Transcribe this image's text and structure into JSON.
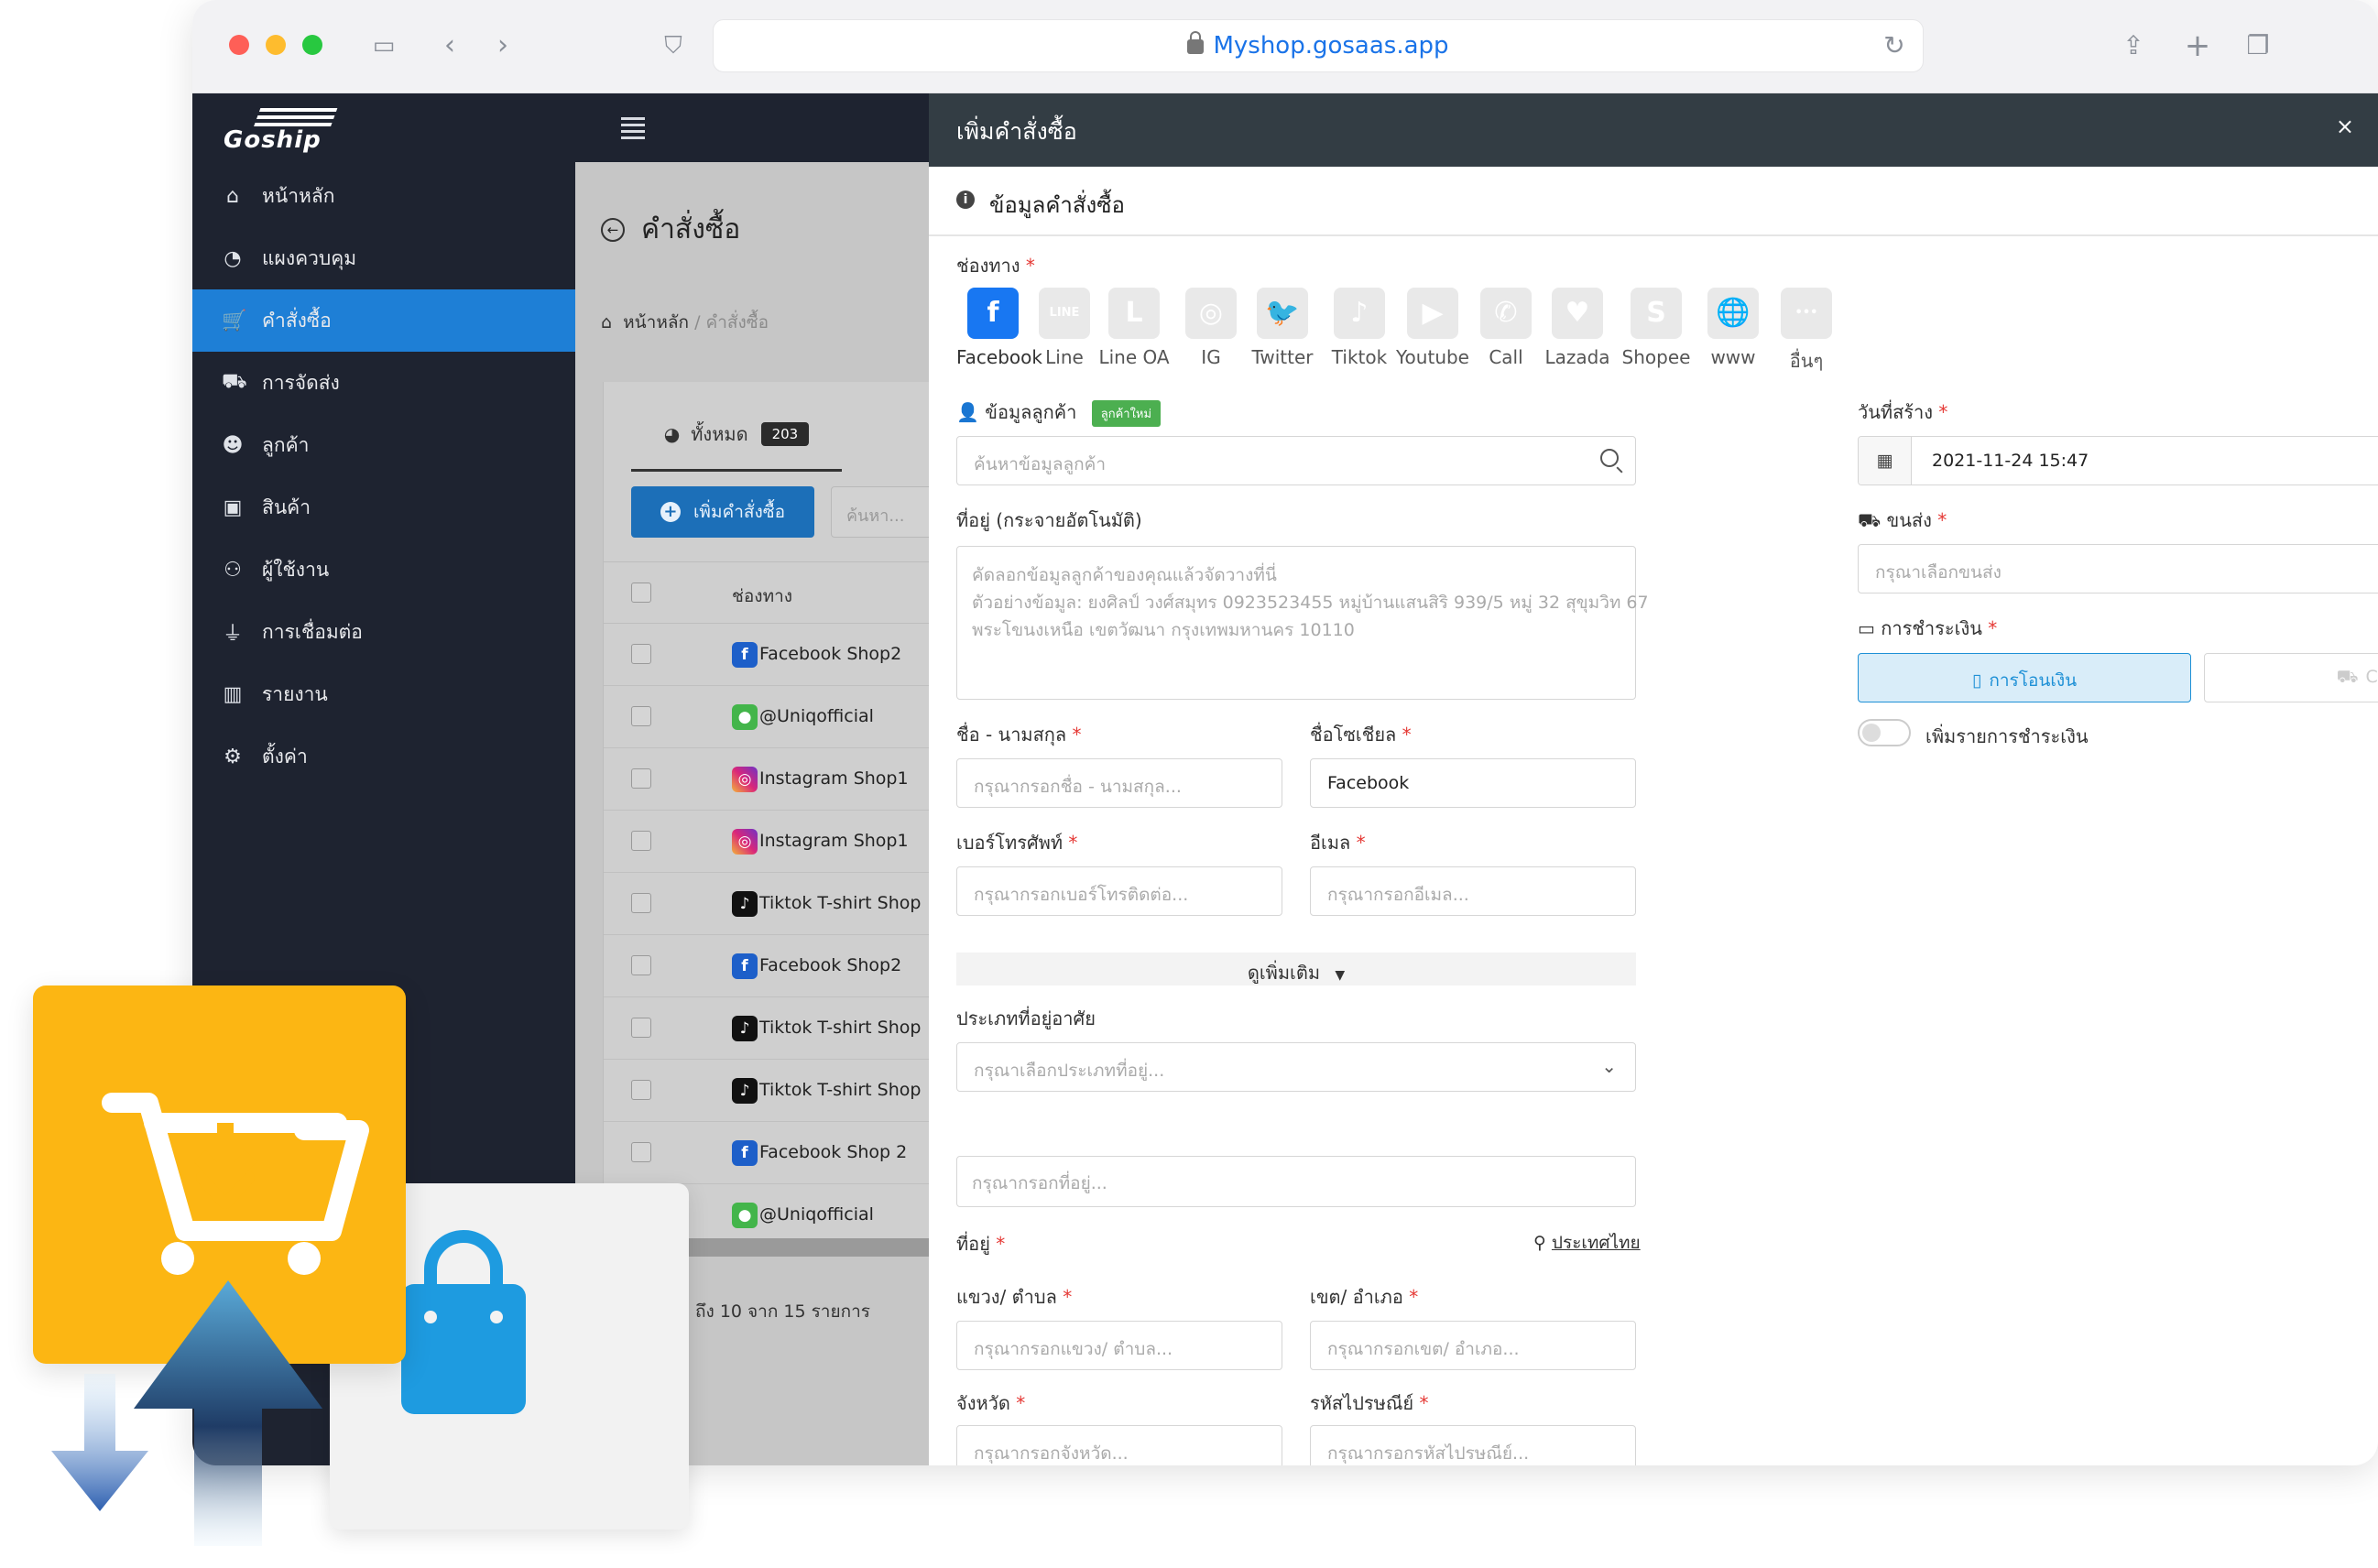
{
  "browser": {
    "url": "Myshop.gosaas.app"
  },
  "app": {
    "logo_text": "Goship"
  },
  "sidebar": {
    "items": [
      {
        "label": "หน้าหลัก",
        "icon": "home-icon",
        "glyph": "⌂"
      },
      {
        "label": "แผงควบคุม",
        "icon": "dashboard-icon",
        "glyph": "◔"
      },
      {
        "label": "คำสั่งซื้อ",
        "icon": "cart-icon",
        "glyph": "🛒",
        "active": true
      },
      {
        "label": "การจัดส่ง",
        "icon": "truck-icon",
        "glyph": "⛟"
      },
      {
        "label": "ลูกค้า",
        "icon": "users-icon",
        "glyph": "☻"
      },
      {
        "label": "สินค้า",
        "icon": "box-icon",
        "glyph": "▣"
      },
      {
        "label": "ผู้ใช้งาน",
        "icon": "user-gear-icon",
        "glyph": "⚇"
      },
      {
        "label": "การเชื่อมต่อ",
        "icon": "plug-icon",
        "glyph": "⏚"
      },
      {
        "label": "รายงาน",
        "icon": "chart-icon",
        "glyph": "▥"
      },
      {
        "label": "ตั้งค่า",
        "icon": "gear-icon",
        "glyph": "⚙"
      }
    ]
  },
  "orders_page": {
    "title": "คำสั่งซื้อ",
    "breadcrumb_home": "หน้าหลัก",
    "breadcrumb_current": "/ คำสั่งซื้อ",
    "tab_all_label": "ทั้งหมด",
    "tab_all_count": "203",
    "add_button": "เพิ่มคำสั่งซื้อ",
    "search_placeholder": "ค้นหา...",
    "column_channel": "ช่องทาง",
    "rows": [
      {
        "channel": "fb",
        "name": "Facebook Shop2"
      },
      {
        "channel": "ln",
        "name": "@Uniqofficial"
      },
      {
        "channel": "insta",
        "name": "Instagram Shop1"
      },
      {
        "channel": "insta",
        "name": "Instagram Shop1"
      },
      {
        "channel": "tk",
        "name": "Tiktok T-shirt Shop"
      },
      {
        "channel": "fb",
        "name": "Facebook Shop2"
      },
      {
        "channel": "tk",
        "name": "Tiktok T-shirt Shop"
      },
      {
        "channel": "tk",
        "name": "Tiktok T-shirt Shop"
      },
      {
        "channel": "fb",
        "name": "Facebook Shop 2"
      },
      {
        "channel": "ln",
        "name": "@Uniqofficial"
      }
    ],
    "pager_text": "ถึง 10 จาก 15 รายการ"
  },
  "modal": {
    "title": "เพิ่มคำสั่งซื้อ",
    "close": "×",
    "section_title": "ข้อมูลคำสั่งซื้อ",
    "channel_label": "ช่องทาง",
    "channels": [
      {
        "label": "Facebook",
        "glyph": "f",
        "icon": "facebook-icon",
        "selected": true
      },
      {
        "label": "Line",
        "glyph": "LINE",
        "icon": "line-icon"
      },
      {
        "label": "Line OA",
        "glyph": "L",
        "icon": "line-oa-icon"
      },
      {
        "label": "IG",
        "glyph": "◎",
        "icon": "instagram-icon"
      },
      {
        "label": "Twitter",
        "glyph": "🐦",
        "icon": "twitter-icon"
      },
      {
        "label": "Tiktok",
        "glyph": "♪",
        "icon": "tiktok-icon"
      },
      {
        "label": "Youtube",
        "glyph": "▶",
        "icon": "youtube-icon"
      },
      {
        "label": "Call",
        "glyph": "✆",
        "icon": "phone-icon"
      },
      {
        "label": "Lazada",
        "glyph": "♥",
        "icon": "lazada-icon"
      },
      {
        "label": "Shopee",
        "glyph": "S",
        "icon": "shopee-icon"
      },
      {
        "label": "www",
        "glyph": "🌐",
        "icon": "globe-icon"
      },
      {
        "label": "อื่นๆ",
        "glyph": "•••",
        "icon": "more-icon"
      }
    ],
    "customer_label": "ข้อมูลลูกค้า",
    "new_customer_badge": "ลูกค้าใหม่",
    "customer_search_placeholder": "ค้นหาข้อมูลลูกค้า",
    "address_auto_label": "ที่อยู่ (กระจายอัตโนมัติ)",
    "address_auto_placeholder_1": "คัดลอกข้อมูลลูกค้าของคุณแล้วจัดวางที่นี่",
    "address_auto_placeholder_2": "ตัวอย่างข้อมูล: ยงศิลป์ วงศ์สมุทร 0923523455 หมู่บ้านแสนสิริ 939/5 หมู่ 32 สุขุมวิท 67",
    "address_auto_placeholder_3": "พระโขนงเหนือ เขตวัฒนา กรุงเทพมหานคร 10110",
    "name_label": "ชื่อ - นามสกุล",
    "name_placeholder": "กรุณากรอกชื่อ - นามสกุล...",
    "social_name_label": "ชื่อโซเชียล",
    "social_name_value": "Facebook",
    "phone_label": "เบอร์โทรศัพท์",
    "phone_placeholder": "กรุณากรอกเบอร์โทรติดต่อ...",
    "email_label": "อีเมล",
    "email_placeholder": "กรุณากรอกอีเมล...",
    "see_more": "ดูเพิ่มเติม",
    "residence_type_label": "ประเภทที่อยู่อาศัย",
    "residence_type_placeholder": "กรุณาเลือกประเภทที่อยู่...",
    "address_detail_placeholder": "กรุณากรอกที่อยู่...",
    "address_label": "ที่อยู่",
    "country_link": "ประเทศไทย",
    "subdistrict_label": "แขวง/ ตำบล",
    "subdistrict_placeholder": "กรุณากรอกแขวง/ ตำบล...",
    "district_label": "เขต/ อำเภอ",
    "district_placeholder": "กรุณากรอกเขต/ อำเภอ...",
    "province_label": "จังหวัด",
    "province_placeholder": "กรุณากรอกจังหวัด...",
    "postcode_label": "รหัสไปรษณีย์",
    "postcode_placeholder": "กรุณากรอกรหัสไปรษณีย์...",
    "created_label": "วันที่สร้าง",
    "created_value": "2021-11-24 15:47",
    "carrier_label": "ขนส่ง",
    "carrier_placeholder": "กรุณาเลือกขนส่ง",
    "payment_label": "การชำระเงิน",
    "payment_transfer": "การโอนเงิน",
    "payment_cod": "COD",
    "add_payment_toggle": "เพิ่มรายการชำระเงิน"
  },
  "colors": {
    "accent": "#1e7fd6",
    "sidebar_bg": "#1e2330",
    "modal_header": "#333d44",
    "deco_yellow": "#fcb613",
    "deco_blue": "#1e9be0"
  }
}
